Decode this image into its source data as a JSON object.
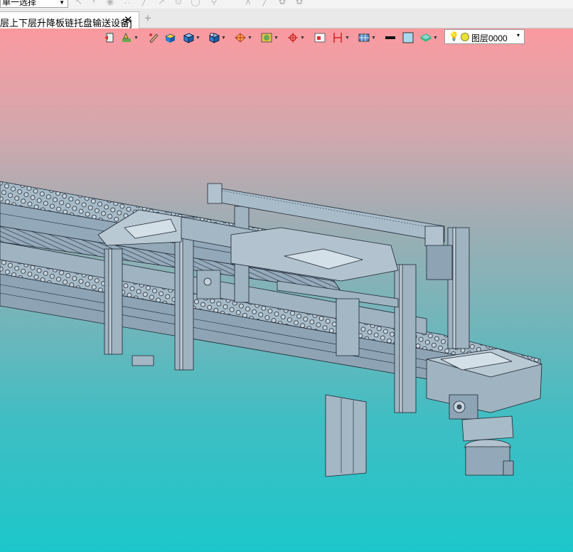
{
  "toolbar_top": {
    "selection_mode": "单一选择",
    "faint_icons": [
      "select-icon",
      "lasso-icon",
      "rotate-view-icon",
      "snap-icon",
      "line-icon",
      "arrow-icon",
      "point-icon",
      "circle-icon",
      "pin-icon",
      "arc-icon",
      "angle-icon",
      "curve-icon",
      "gear-icon",
      "gear-icon"
    ]
  },
  "tabs": {
    "document_title": "层上下层升降板链托盘输送设备]",
    "close_glyph": "✕",
    "new_tab_glyph": "+"
  },
  "hud": {
    "icons": [
      "view-orientation-icon",
      "display-style-icon",
      "edit-color-icon",
      "appearance-icon",
      "3d-box-icon",
      "view-cube-icon",
      "section-icon",
      "render-icon",
      "zoom-fit-icon",
      "pan-icon",
      "dimension-icon",
      "grid-icon",
      "line-color-icon",
      "fill-color-icon",
      "material-icon"
    ],
    "layer": {
      "name": "图层0000",
      "bulb_glyph": "💡",
      "arrow_glyph": "▾"
    }
  },
  "colors": {
    "background_top": "#fb9aa0",
    "background_bottom": "#1cc7cb",
    "model_fill": "#9fb3c1",
    "model_line": "#1b2430"
  }
}
